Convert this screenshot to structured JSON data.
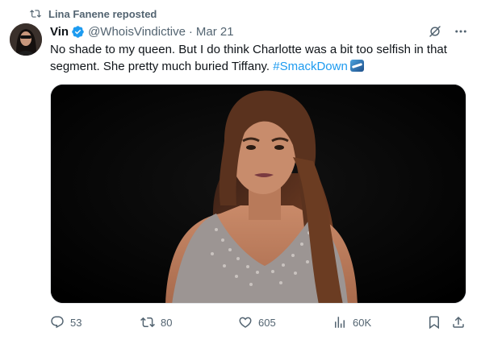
{
  "repost": {
    "text": "Lina Fanene reposted"
  },
  "tweet": {
    "author_name": "Vin",
    "handle": "@WhoisVindictive",
    "separator": "·",
    "date": "Mar 21",
    "text_main": "No shade to my queen. But I do think Charlotte was a bit too selfish in that segment. She pretty much buried Tiffany. ",
    "hashtag": "#SmackDown"
  },
  "actions": {
    "replies": "53",
    "reposts": "80",
    "likes": "605",
    "views": "60K"
  },
  "colors": {
    "accent": "#1d9bf0",
    "muted": "#536471",
    "text": "#0f1419"
  },
  "icons": [
    "repost-icon",
    "verified-badge-icon",
    "grok-icon",
    "more-icon",
    "reply-icon",
    "like-icon",
    "views-icon",
    "bookmark-icon",
    "share-icon"
  ]
}
